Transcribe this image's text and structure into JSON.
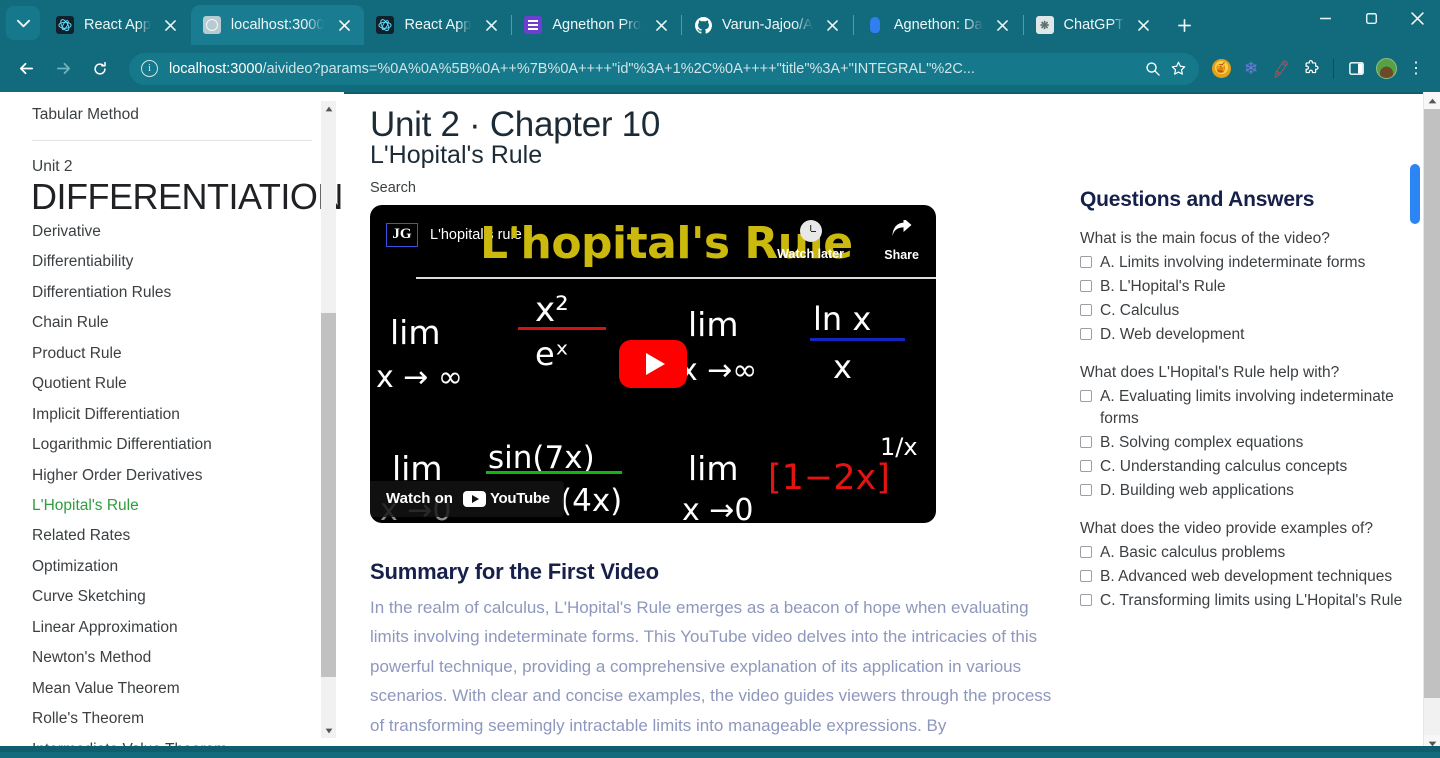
{
  "browser": {
    "tabs": [
      {
        "title": "React App",
        "favicon": "react-icon",
        "active": false
      },
      {
        "title": "localhost:3000",
        "favicon": "globe-icon",
        "active": true
      },
      {
        "title": "React App",
        "favicon": "react-icon",
        "active": false
      },
      {
        "title": "Agnethon Pro",
        "favicon": "sheets-icon",
        "active": false
      },
      {
        "title": "Varun-Jajoo/A",
        "favicon": "github-icon",
        "active": false
      },
      {
        "title": "Agnethon: Da",
        "favicon": "blue-doc-icon",
        "active": false
      },
      {
        "title": "ChatGPT",
        "favicon": "chatgpt-icon",
        "active": false
      }
    ],
    "tab_list_label": "Search tabs",
    "new_tab_label": "+",
    "window_controls": {
      "minimize": "—",
      "maximize": "❐",
      "close": "✕"
    },
    "toolbar": {
      "back": "back-arrow",
      "forward": "forward-arrow",
      "reload": "reload",
      "site_info": "i",
      "url_bold": "localhost:3000",
      "url_rest": "/aivideo?params=%0A%0A%5B%0A++%7B%0A++++\"id\"%3A+1%2C%0A++++\"title\"%3A+\"INTEGRAL\"%2C...",
      "search_icon": "search-icon",
      "bookmark_icon": "star-icon",
      "extensions": [
        "honey-extension-icon",
        "snowflake-extension-icon",
        "pen-extension-icon",
        "puzzle-extensions-icon",
        "side-panel-icon",
        "profile-avatar",
        "chrome-menu-icon"
      ]
    }
  },
  "leftnav": {
    "top_item": "Tabular Method",
    "unit_label": "Unit 2",
    "unit_title": "DIFFERENTIATION",
    "items": [
      {
        "label": "Derivative",
        "active": false
      },
      {
        "label": "Differentiability",
        "active": false
      },
      {
        "label": "Differentiation Rules",
        "active": false
      },
      {
        "label": "Chain Rule",
        "active": false
      },
      {
        "label": "Product Rule",
        "active": false
      },
      {
        "label": "Quotient Rule",
        "active": false
      },
      {
        "label": "Implicit Differentiation",
        "active": false
      },
      {
        "label": "Logarithmic Differentiation",
        "active": false
      },
      {
        "label": "Higher Order Derivatives",
        "active": false
      },
      {
        "label": "L'Hopital's Rule",
        "active": true
      },
      {
        "label": "Related Rates",
        "active": false
      },
      {
        "label": "Optimization",
        "active": false
      },
      {
        "label": "Curve Sketching",
        "active": false
      },
      {
        "label": "Linear Approximation",
        "active": false
      },
      {
        "label": "Newton's Method",
        "active": false
      },
      {
        "label": "Mean Value Theorem",
        "active": false
      },
      {
        "label": "Rolle's Theorem",
        "active": false
      },
      {
        "label": "Intermediate Value Theorem",
        "active": false
      }
    ],
    "active_color": "#2e9e3c"
  },
  "main": {
    "header_unit_chapter": "Unit 2 · Chapter 10",
    "header_topic": "L'Hopital's Rule",
    "search_label": "Search",
    "video": {
      "channel_badge": "JG",
      "title": "L'hopital's rule",
      "overlay_title": "L'hopital's Rule",
      "watch_later_label": "Watch later",
      "share_label": "Share",
      "watch_on_label": "Watch on",
      "youtube_label": "YouTube",
      "play_label": "Play",
      "math": [
        "lim",
        "x → ∞",
        "x²",
        "eˣ",
        "lim",
        "x →∞",
        "ln x",
        "x",
        "lim",
        "x →0",
        "sin(7x)",
        "(4x)",
        "lim",
        "x →0",
        "[1−2x]",
        "1/x"
      ]
    },
    "summary_title": "Summary for the First Video",
    "summary_body": "In the realm of calculus, L'Hopital's Rule emerges as a beacon of hope when evaluating limits involving indeterminate forms. This YouTube video delves into the intricacies of this powerful technique, providing a comprehensive explanation of its application in various scenarios. With clear and concise examples, the video guides viewers through the process of transforming seemingly intractable limits into manageable expressions. By"
  },
  "qa": {
    "title": "Questions and Answers",
    "questions": [
      {
        "question": "What is the main focus of the video?",
        "options": [
          "A. Limits involving indeterminate forms",
          "B. L'Hopital's Rule",
          "C. Calculus",
          "D. Web development"
        ]
      },
      {
        "question": "What does L'Hopital's Rule help with?",
        "options": [
          "A. Evaluating limits involving indeterminate forms",
          "B. Solving complex equations",
          "C. Understanding calculus concepts",
          "D. Building web applications"
        ]
      },
      {
        "question": "What does the video provide examples of?",
        "options": [
          "A. Basic calculus problems",
          "B. Advanced web development techniques",
          "C. Transforming limits using L'Hopital's Rule"
        ]
      }
    ]
  },
  "colors": {
    "chrome": "#126b7c",
    "chrome_active_tab": "#1a7c90",
    "accent_green": "#2e9e3c",
    "heading_navy": "#16204a",
    "body_muted": "#8e97bd",
    "scroll_thumb_blue": "#2b85f5"
  }
}
